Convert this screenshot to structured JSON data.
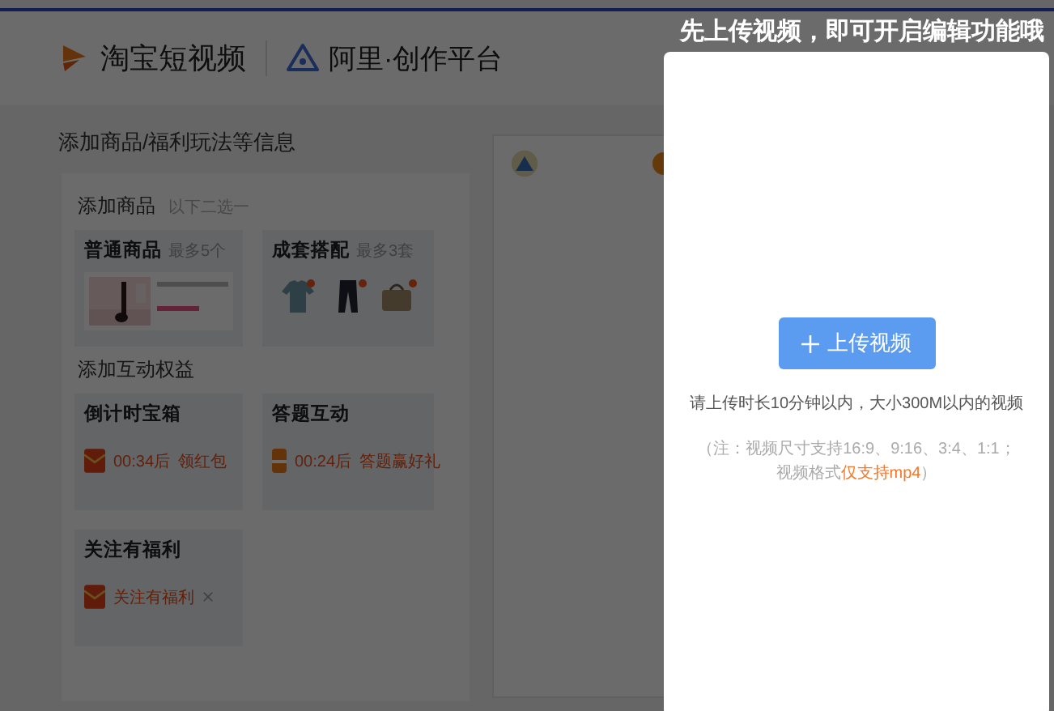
{
  "header": {
    "brand": "淘宝短视频",
    "platform": "阿里·创作平台"
  },
  "form": {
    "title": "添加商品/福利玩法等信息",
    "sections": [
      {
        "title": "添加商品",
        "hint": "以下二选一",
        "cards": [
          {
            "kind": "product",
            "title": "普通商品",
            "hint": "最多5个"
          },
          {
            "kind": "outfit",
            "title": "成套搭配",
            "hint": "最多3套"
          }
        ]
      },
      {
        "title": "添加互动权益",
        "cards": [
          {
            "kind": "countdown",
            "title": "倒计时宝箱",
            "time": "00:34后",
            "action": "领红包"
          },
          {
            "kind": "quiz",
            "title": "答题互动",
            "time": "00:24后",
            "action": "答题赢好礼"
          },
          {
            "kind": "follow",
            "title": "关注有福利",
            "action": "关注有福利"
          }
        ]
      }
    ]
  },
  "modal": {
    "heading": "先上传视频，即可开启编辑功能哦",
    "button": "上传视频",
    "hint": "请上传时长10分钟以内，大小300M以内的视频",
    "note": {
      "line1": "（注：视频尺寸支持16:9、9:16、3:4、1:1；",
      "prefix": "视频格式",
      "highlight": "仅支持mp4",
      "suffix": "）"
    }
  }
}
